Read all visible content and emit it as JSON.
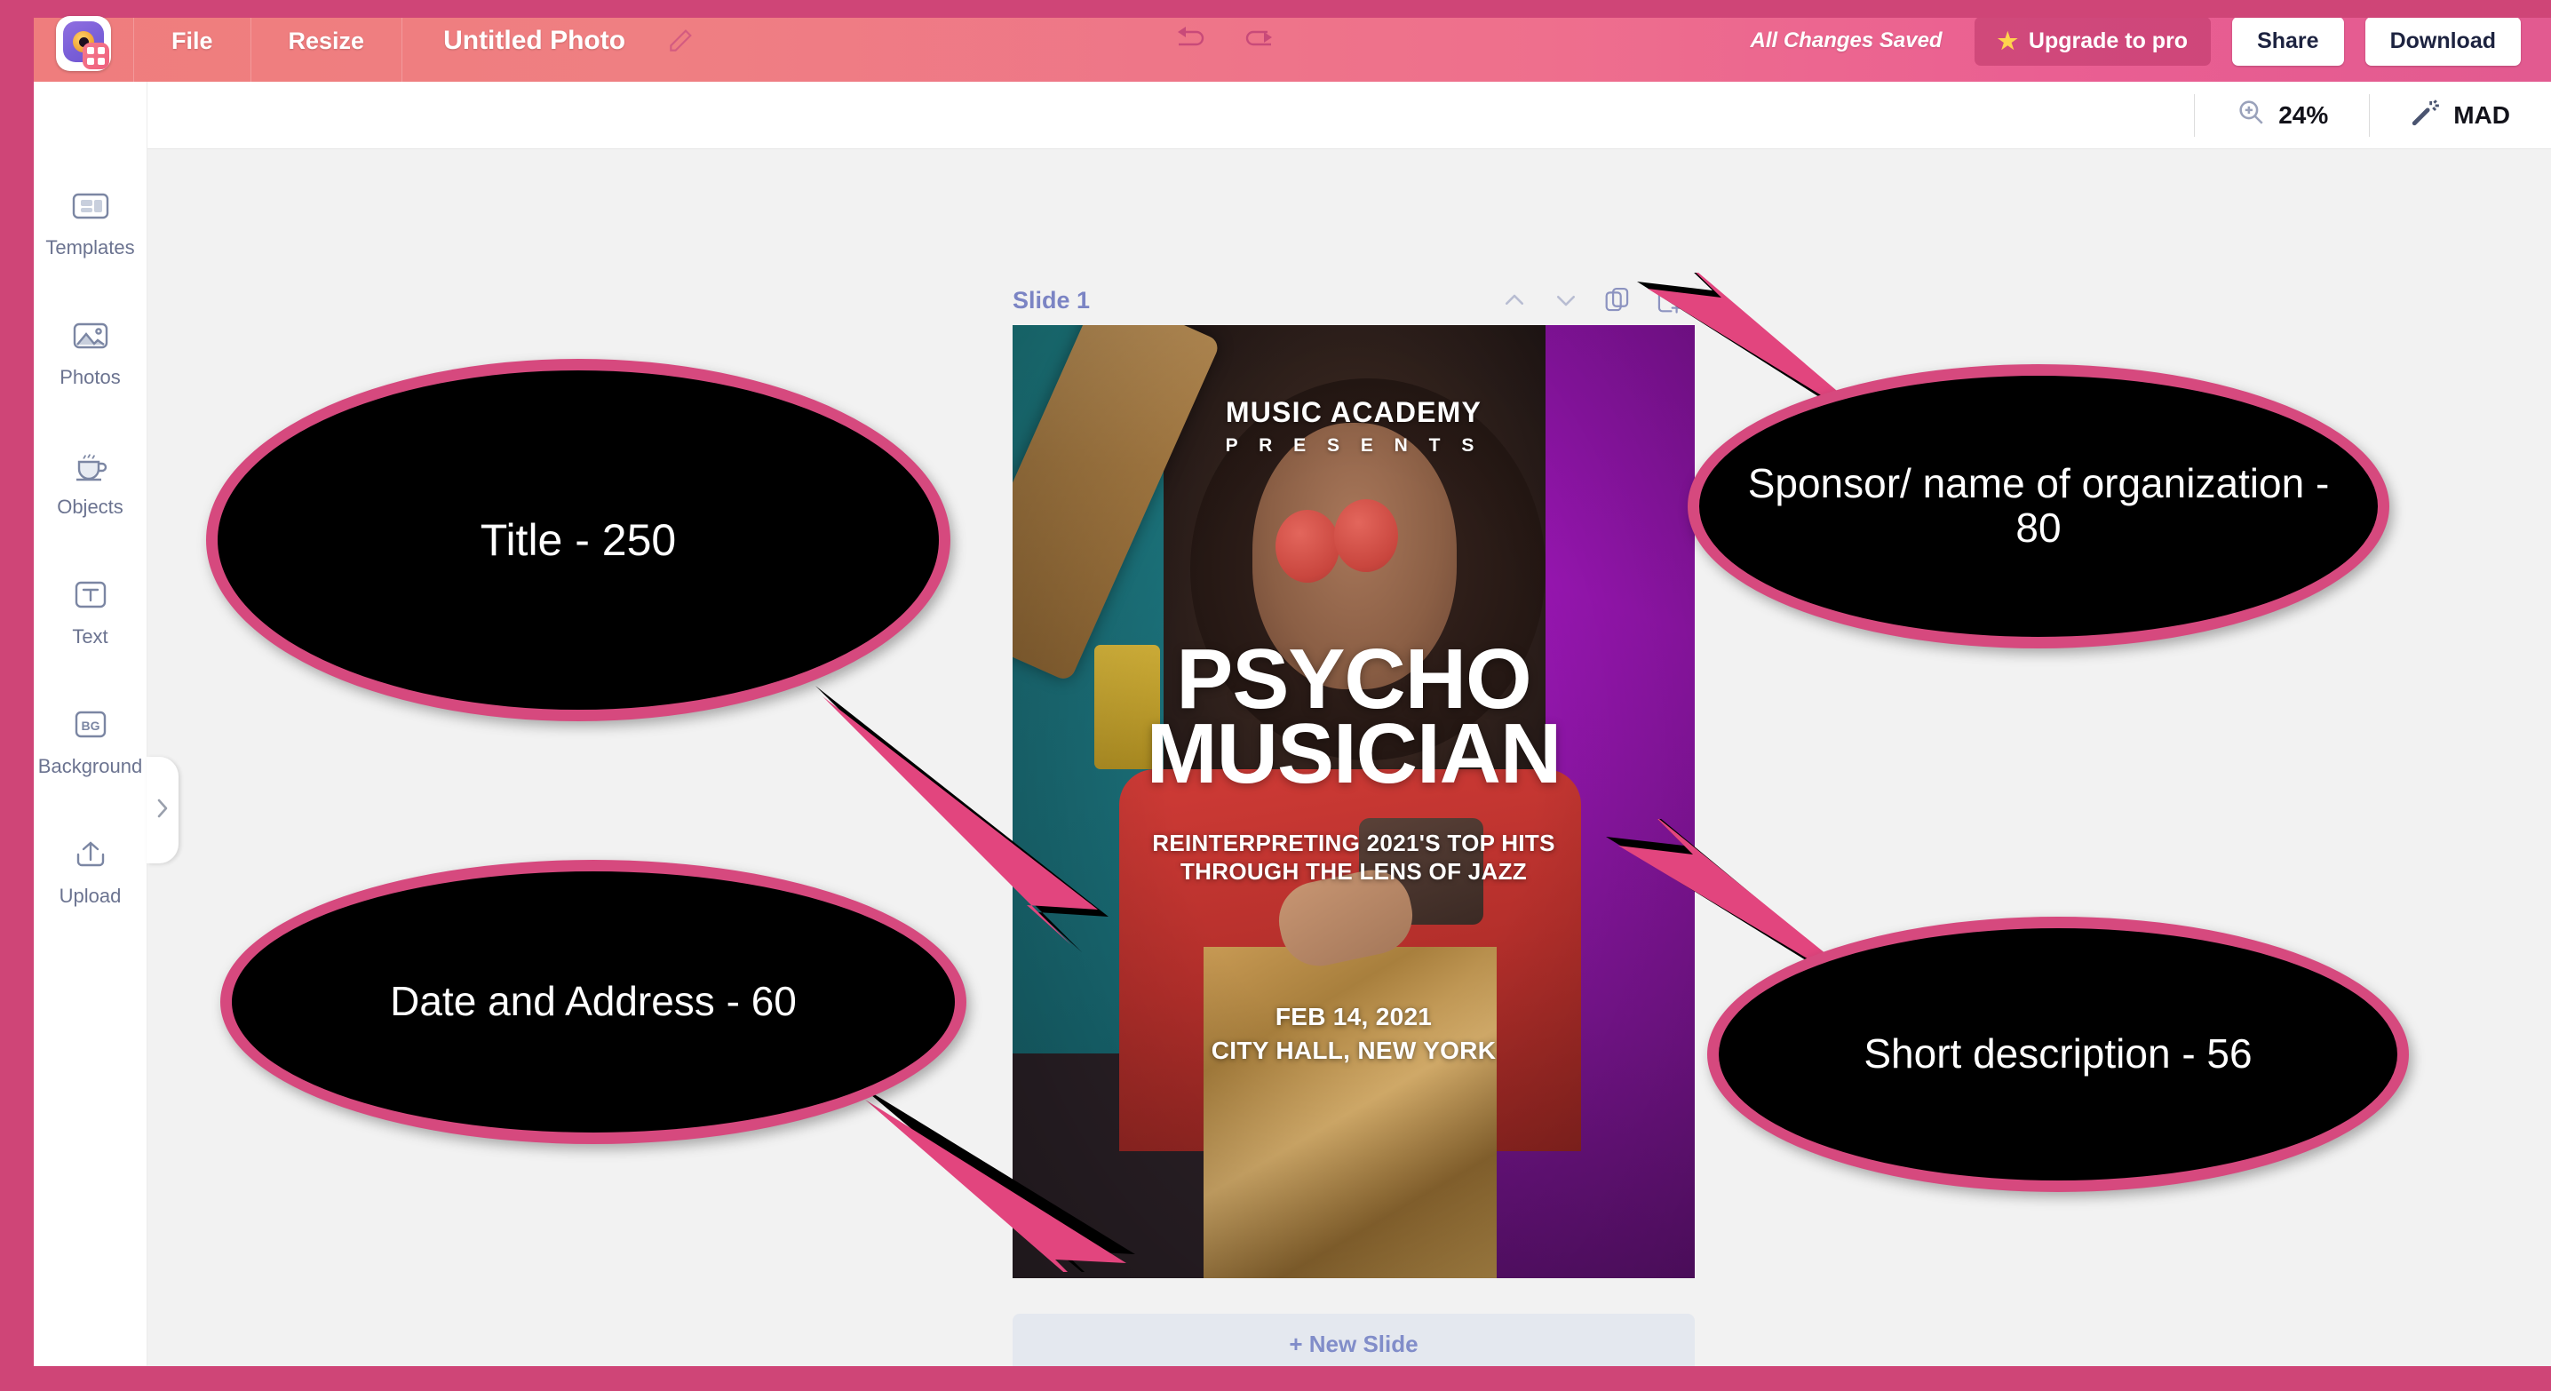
{
  "app": {
    "logo_name": "photo-editor-logo",
    "accent_pink": "#cf4577",
    "toolbar_gradient_start": "#ef7d7d",
    "toolbar_gradient_end": "#e25a90"
  },
  "topbar": {
    "menu_file": "File",
    "menu_resize": "Resize",
    "document_title": "Untitled Photo",
    "rename_icon": "pencil-icon",
    "undo_icon": "undo-arrow-icon",
    "redo_icon": "redo-arrow-icon",
    "save_status": "All Changes Saved",
    "upgrade_label": "Upgrade to pro",
    "upgrade_icon": "star-icon",
    "share_label": "Share",
    "download_label": "Download"
  },
  "subbar": {
    "zoom_icon": "zoom-in-magnifier-icon",
    "zoom_level": "24%",
    "magic_icon": "magic-wand-icon",
    "magic_label": "MAD"
  },
  "sidebar": {
    "expander_icon": "chevron-right-icon",
    "items": [
      {
        "label": "Templates",
        "icon": "templates-icon"
      },
      {
        "label": "Photos",
        "icon": "photos-image-icon"
      },
      {
        "label": "Objects",
        "icon": "objects-cup-icon"
      },
      {
        "label": "Text",
        "icon": "text-t-icon"
      },
      {
        "label": "Background",
        "icon": "background-bg-icon"
      },
      {
        "label": "Upload",
        "icon": "upload-arrow-icon"
      }
    ]
  },
  "canvas": {
    "slide_label": "Slide 1",
    "move_up_icon": "chevron-up-icon",
    "move_down_icon": "chevron-down-icon",
    "duplicate_icon": "duplicate-slide-icon",
    "add_slide_icon": "add-slide-icon",
    "new_slide_label": "+ New Slide"
  },
  "poster": {
    "organization": "MUSIC ACADEMY",
    "presents": "P R E S E N T S",
    "title_line1": "PSYCHO",
    "title_line2": "MUSICIAN",
    "description_line1": "REINTERPRETING 2021'S TOP HITS",
    "description_line2": "THROUGH THE LENS OF JAZZ",
    "date": "FEB 14, 2021",
    "address": "CITY HALL, NEW YORK"
  },
  "annotations": [
    {
      "id": "title",
      "text": "Title - 250"
    },
    {
      "id": "sponsor",
      "text": "Sponsor/ name of organization - 80"
    },
    {
      "id": "date",
      "text": "Date and Address - 60"
    },
    {
      "id": "desc",
      "text": "Short description - 56"
    }
  ],
  "annotation_color": "#d6497e"
}
